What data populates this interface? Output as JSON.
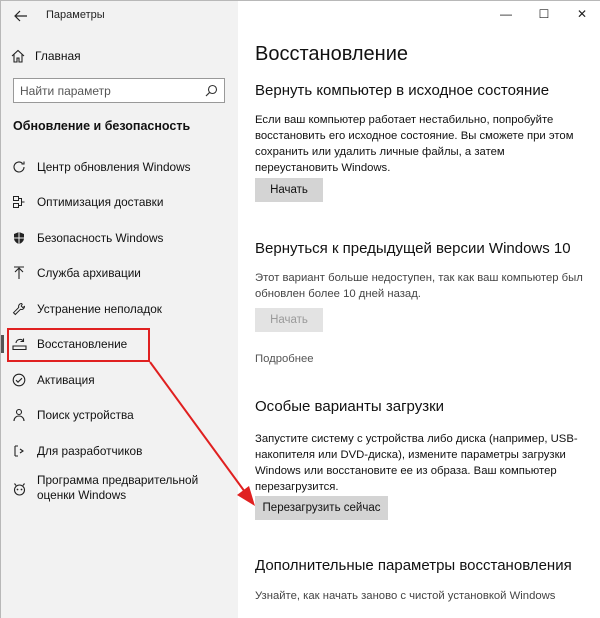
{
  "window": {
    "title": "Параметры",
    "controls": {
      "minimize": "—",
      "maximize": "☐",
      "close": "✕"
    }
  },
  "sidebar": {
    "home_label": "Главная",
    "search_placeholder": "Найти параметр",
    "section_title": "Обновление и безопасность",
    "items": [
      {
        "label": "Центр обновления Windows",
        "icon": "refresh-icon"
      },
      {
        "label": "Оптимизация доставки",
        "icon": "delivery-optimization-icon"
      },
      {
        "label": "Безопасность Windows",
        "icon": "shield-icon"
      },
      {
        "label": "Служба архивации",
        "icon": "backup-arrow-icon"
      },
      {
        "label": "Устранение неполадок",
        "icon": "wrench-icon"
      },
      {
        "label": "Восстановление",
        "icon": "recovery-icon",
        "active": true
      },
      {
        "label": "Активация",
        "icon": "check-circle-icon"
      },
      {
        "label": "Поиск устройства",
        "icon": "person-location-icon"
      },
      {
        "label": "Для разработчиков",
        "icon": "developer-icon"
      },
      {
        "label": "Программа предварительной оценки Windows",
        "icon": "insider-icon"
      }
    ]
  },
  "main": {
    "title": "Восстановление",
    "reset": {
      "heading": "Вернуть компьютер в исходное состояние",
      "description": "Если ваш компьютер работает нестабильно, попробуйте восстановить его исходное состояние. Вы сможете при этом сохранить или удалить личные файлы, а затем переустановить Windows.",
      "button": "Начать"
    },
    "rollback": {
      "heading": "Вернуться к предыдущей версии Windows 10",
      "description": "Этот вариант больше недоступен, так как ваш компьютер был обновлен более 10 дней назад.",
      "button": "Начать",
      "link": "Подробнее"
    },
    "advanced_startup": {
      "heading": "Особые варианты загрузки",
      "description": "Запустите систему с устройства либо диска (например, USB-накопителя или DVD-диска), измените параметры загрузки Windows или восстановите ее из образа. Ваш компьютер перезагрузится.",
      "button": "Перезагрузить сейчас"
    },
    "more_options": {
      "heading": "Дополнительные параметры восстановления",
      "description": "Узнайте, как начать заново с чистой установкой Windows"
    }
  },
  "colors": {
    "highlight": "#e02020",
    "sidebar_bg": "#f2f2f2",
    "button_bg": "#d4d4d4"
  }
}
